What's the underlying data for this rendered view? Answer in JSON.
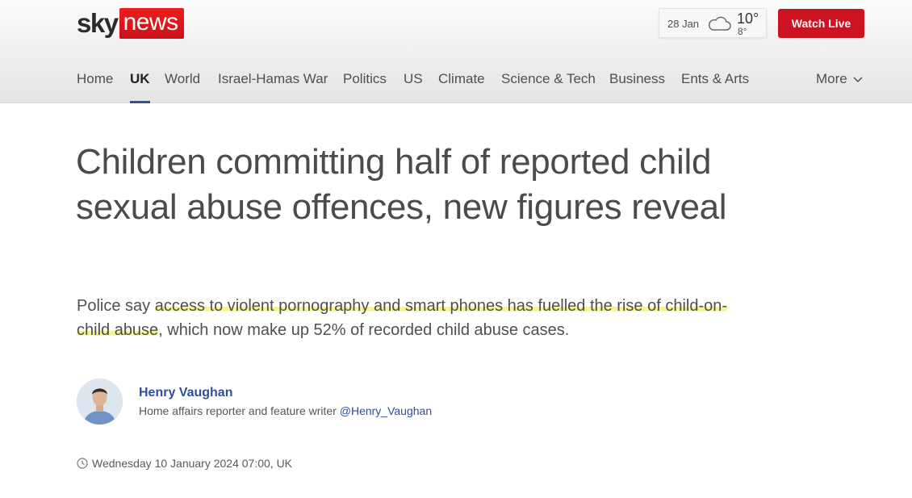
{
  "logo": {
    "sky": "sky",
    "news": "news"
  },
  "weather": {
    "date": "28 Jan",
    "icon": "cloud-icon",
    "high": "10°",
    "low": "8°"
  },
  "watch_live": "Watch Live",
  "nav": {
    "items": [
      {
        "label": "Home"
      },
      {
        "label": "UK",
        "active": true
      },
      {
        "label": "World"
      },
      {
        "label": "Israel-Hamas War"
      },
      {
        "label": "Politics"
      },
      {
        "label": "US"
      },
      {
        "label": "Climate"
      },
      {
        "label": "Science & Tech"
      },
      {
        "label": "Business"
      },
      {
        "label": "Ents & Arts"
      }
    ],
    "more": "More"
  },
  "article": {
    "headline": "Children committing half of reported child sexual abuse offences, new figures reveal",
    "standfirst": {
      "before": "Police say ",
      "highlight": "access to violent pornography and smart phones has fuelled the rise of child-on-child abuse",
      "after": ", which now make up 52% of recorded child abuse cases."
    },
    "author": {
      "name": "Henry Vaughan",
      "role": "Home affairs reporter and feature writer ",
      "handle": "@Henry_Vaughan"
    },
    "dateline": "Wednesday 10 January 2024 07:00, UK"
  },
  "colors": {
    "brand_red": "#cd1321",
    "link_blue": "#2d4f9a",
    "highlight_yellow": "#f5f392"
  }
}
